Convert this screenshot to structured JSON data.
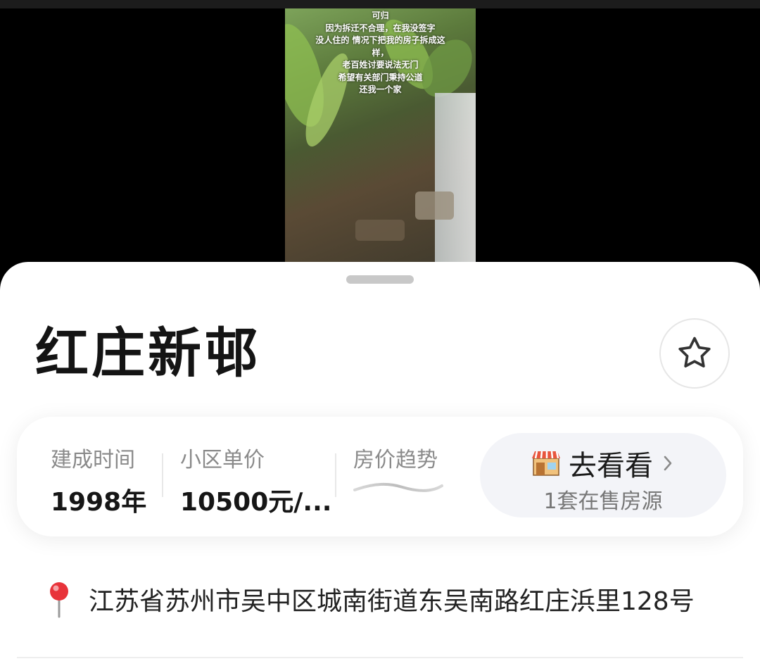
{
  "video": {
    "overlay_lines": [
      "可归",
      "因为拆迁不合理，在我没签字",
      "没人住的 情况下把我的房子拆成这",
      "样，",
      "老百姓讨要说法无门",
      "希望有关部门秉持公道",
      "还我一个家"
    ]
  },
  "community": {
    "name": "红庄新邨",
    "favorite_icon": "star-outline-icon"
  },
  "stats": {
    "build_year_label": "建成时间",
    "build_year_value": "1998年",
    "unit_price_label": "小区单价",
    "unit_price_value": "10500元/...",
    "trend_label": "房价趋势"
  },
  "listing_button": {
    "label": "去看看",
    "sub_label": "1套在售房源",
    "icon": "shop-icon"
  },
  "address": {
    "icon": "location-pin-icon",
    "text": "江苏省苏州市吴中区城南街道东吴南路红庄浜里128号"
  },
  "colors": {
    "sheet_bg": "#ffffff",
    "button_bg": "#f3f4f8",
    "pin_red": "#e8333a"
  }
}
